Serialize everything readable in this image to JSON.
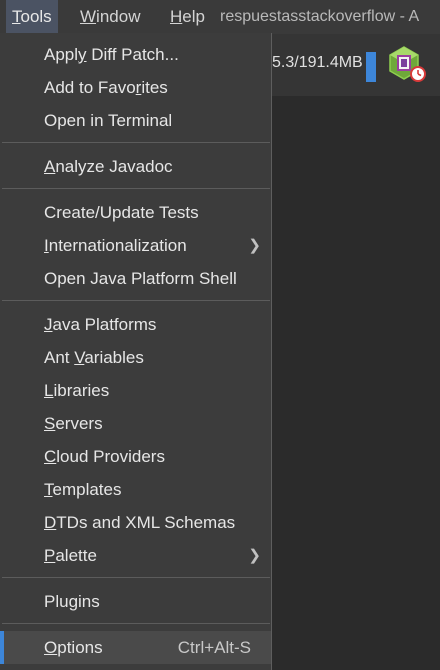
{
  "menubar": {
    "items": [
      {
        "label": "Tools",
        "mnemonic": "T",
        "active": true
      },
      {
        "label": "Window",
        "mnemonic": "W",
        "active": false
      },
      {
        "label": "Help",
        "mnemonic": "H",
        "active": false
      }
    ],
    "window_title": "respuestasstackoverflow - A"
  },
  "toolbar": {
    "memory_usage": "5.3/191.4MB",
    "profiler_icon": "profiler-icon",
    "gc_icon": "clock-icon",
    "colors": {
      "memory_bar": "#3d86d9",
      "accent": "#3d86d9"
    }
  },
  "menu": {
    "submenu_arrow_icon": "chevron-right-icon",
    "sections": [
      [
        {
          "label": "Apply Diff Patch...",
          "mnemonic": "y"
        },
        {
          "label": "Add to Favorites",
          "mnemonic": "r"
        },
        {
          "label": "Open in Terminal"
        }
      ],
      [
        {
          "label": "Analyze Javadoc",
          "mnemonic": "A"
        }
      ],
      [
        {
          "label": "Create/Update Tests"
        },
        {
          "label": "Internationalization",
          "mnemonic": "I",
          "submenu": true
        },
        {
          "label": "Open Java Platform Shell"
        }
      ],
      [
        {
          "label": "Java Platforms",
          "mnemonic": "J"
        },
        {
          "label": "Ant Variables",
          "mnemonic": "V"
        },
        {
          "label": "Libraries",
          "mnemonic": "L"
        },
        {
          "label": "Servers",
          "mnemonic": "S"
        },
        {
          "label": "Cloud Providers",
          "mnemonic": "C"
        },
        {
          "label": "Templates",
          "mnemonic": "T"
        },
        {
          "label": "DTDs and XML Schemas",
          "mnemonic": "D"
        },
        {
          "label": "Palette",
          "mnemonic": "P",
          "submenu": true
        }
      ],
      [
        {
          "label": "Plugins"
        }
      ],
      [
        {
          "label": "Options",
          "mnemonic": "O",
          "shortcut": "Ctrl+Alt-S",
          "selected": true
        }
      ]
    ]
  }
}
